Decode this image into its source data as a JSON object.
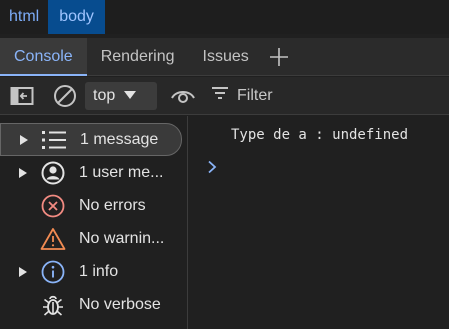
{
  "breadcrumbs": [
    "html",
    "body"
  ],
  "tabs": {
    "console": "Console",
    "rendering": "Rendering",
    "issues": "Issues"
  },
  "toolbar": {
    "context": "top",
    "filter_placeholder": "Filter"
  },
  "sidebar": {
    "items": [
      {
        "label": "1 message",
        "icon": "list-icon"
      },
      {
        "label": "1 user me...",
        "icon": "user-icon"
      },
      {
        "label": "No errors",
        "icon": "error-icon"
      },
      {
        "label": "No warnin...",
        "icon": "warning-icon"
      },
      {
        "label": "1 info",
        "icon": "info-icon"
      },
      {
        "label": "No verbose",
        "icon": "bug-icon"
      }
    ]
  },
  "console": {
    "log": "Type de a : undefined"
  },
  "colors": {
    "accent": "#8ab4f8",
    "selected_crumb": "#074c8f",
    "error": "#f28b82",
    "warning": "#fdd663"
  }
}
